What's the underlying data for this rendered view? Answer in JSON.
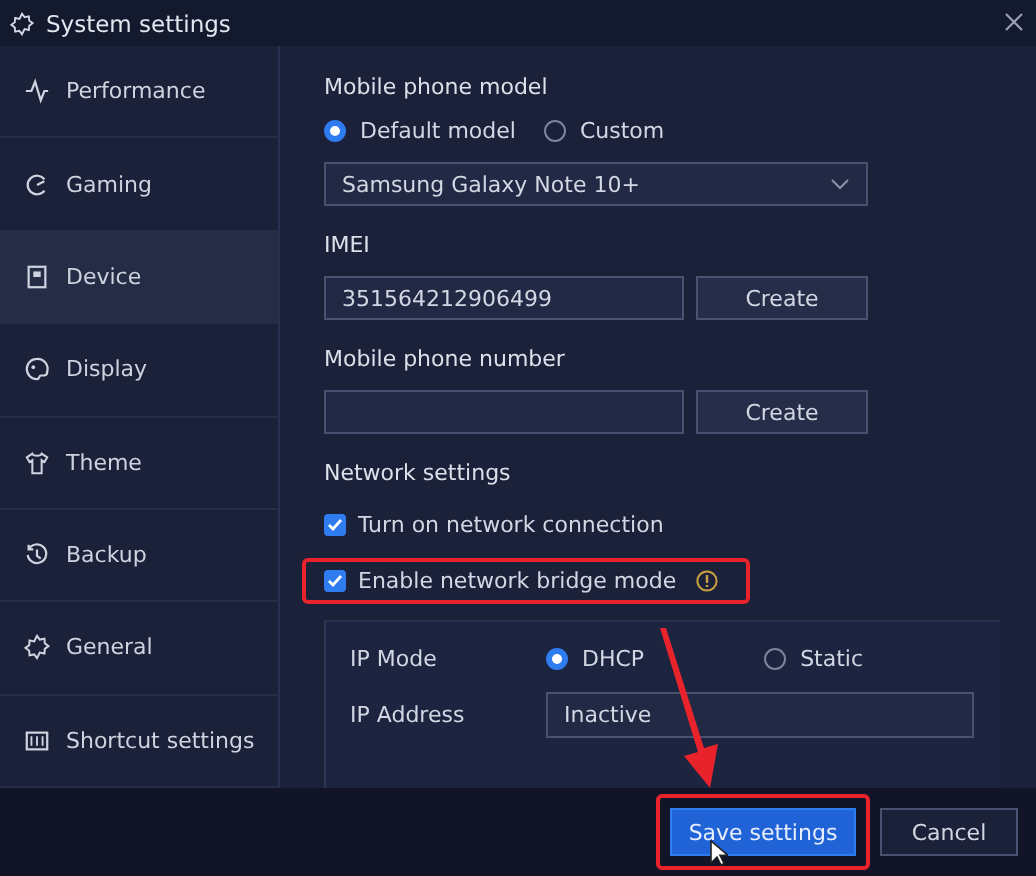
{
  "window": {
    "title": "System settings"
  },
  "sidebar": {
    "items": [
      {
        "label": "Performance",
        "selected": false
      },
      {
        "label": "Gaming",
        "selected": false
      },
      {
        "label": "Device",
        "selected": true
      },
      {
        "label": "Display",
        "selected": false
      },
      {
        "label": "Theme",
        "selected": false
      },
      {
        "label": "Backup",
        "selected": false
      },
      {
        "label": "General",
        "selected": false
      },
      {
        "label": "Shortcut settings",
        "selected": false
      }
    ]
  },
  "phone_model": {
    "heading": "Mobile phone model",
    "options": [
      {
        "label": "Default model",
        "selected": true
      },
      {
        "label": "Custom",
        "selected": false
      }
    ],
    "dropdown": "Samsung Galaxy Note 10+"
  },
  "imei": {
    "heading": "IMEI",
    "value": "351564212906499",
    "button": "Create"
  },
  "phone_number": {
    "heading": "Mobile phone number",
    "button": "Create"
  },
  "network": {
    "heading": "Network settings",
    "checkboxes": [
      {
        "label": "Turn on network connection",
        "checked": true,
        "info": false,
        "highlighted": false
      },
      {
        "label": "Enable network bridge mode",
        "checked": true,
        "info": true,
        "highlighted": true
      }
    ],
    "ip_mode": {
      "label": "IP Mode",
      "options": [
        {
          "label": "DHCP",
          "selected": true
        },
        {
          "label": "Static",
          "selected": false
        }
      ]
    },
    "ip_address": {
      "label": "IP Address",
      "value": "Inactive"
    }
  },
  "footer": {
    "buttons": [
      {
        "label": "Save settings",
        "kind": "primary",
        "highlighted": true
      },
      {
        "label": "Cancel",
        "kind": "secondary",
        "highlighted": false
      }
    ]
  }
}
